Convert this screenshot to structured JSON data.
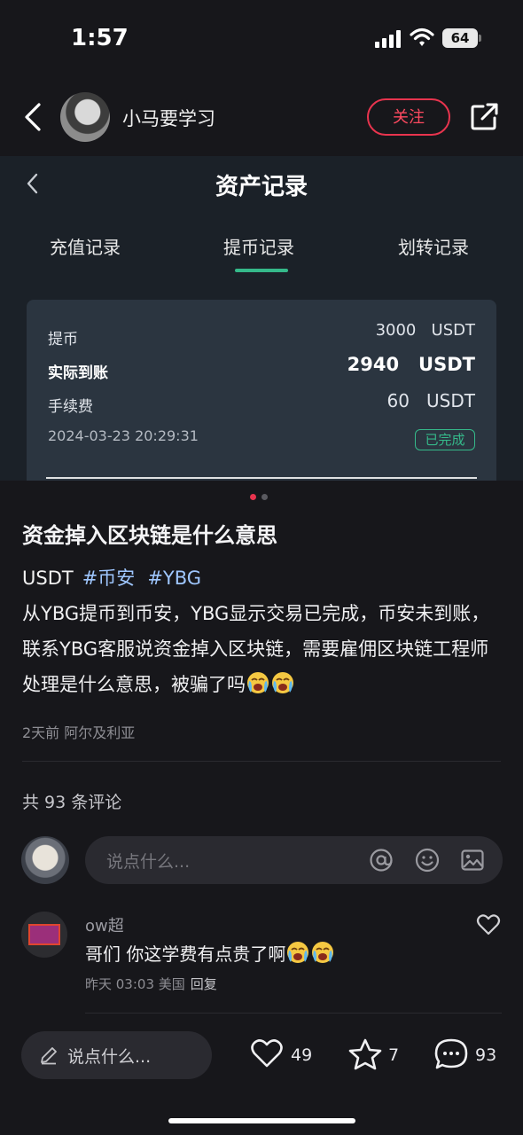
{
  "status_bar": {
    "time": "1:57",
    "battery": "64"
  },
  "header": {
    "author": "小马要学习",
    "follow_label": "关注"
  },
  "image": {
    "title": "资产记录",
    "tabs": [
      "充值记录",
      "提币记录",
      "划转记录"
    ],
    "active_tab": "提币记录",
    "record": {
      "withdraw_label": "提币",
      "withdraw_value": "3000   USDT",
      "received_label": "实际到账",
      "received_value": "2940   USDT",
      "fee_label": "手续费",
      "fee_value": "60   USDT",
      "datetime": "2024-03-23 20:29:31",
      "status": "已完成"
    },
    "pager": {
      "pages": 2,
      "current": 1
    }
  },
  "post": {
    "title": "资金掉入区块链是什么意思",
    "tags": {
      "plain": "USDT",
      "tag1": "#币安",
      "tag2": "#YBG"
    },
    "body": "从YBG提币到币安，YBG显示交易已完成，币安未到账，联系YBG客服说资金掉入区块链，需要雇佣区块链工程师处理是什么意思，被骗了吗",
    "body_emojis": [
      "crying-face-emoji",
      "crying-face-emoji"
    ],
    "meta": "2天前 阿尔及利亚"
  },
  "comments": {
    "count_text": "共 93 条评论",
    "input_placeholder": "说点什么...",
    "items": [
      {
        "name": "ow超",
        "text": "哥们 你这学费有点贵了啊",
        "emojis": [
          "crying-face-emoji",
          "crying-face-emoji"
        ],
        "meta": "昨天 03:03 美国",
        "reply_label": "回复"
      }
    ]
  },
  "bottom_bar": {
    "input_placeholder": "说点什么...",
    "likes": "49",
    "favorites": "7",
    "comments": "93"
  },
  "colors": {
    "accent_red": "#e8344e",
    "accent_green": "#35b98a",
    "tag_blue": "#9fc7ff",
    "background": "#17171b"
  }
}
